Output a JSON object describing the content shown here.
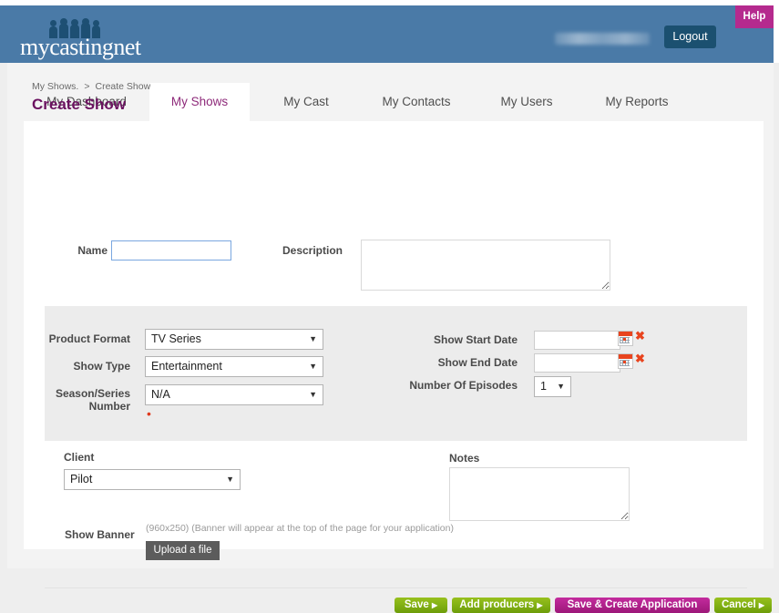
{
  "header": {
    "logo_text": "mycastingnet",
    "logo_icon": "people-group-icon",
    "username": "",
    "logout_label": "Logout",
    "help_label": "Help",
    "bar_color": "#4a7aa7",
    "help_color": "#b52a8e",
    "logout_color": "#1b5070"
  },
  "tabs": [
    {
      "label": "My Dashboard",
      "active": false
    },
    {
      "label": "My Shows",
      "active": true
    },
    {
      "label": "My Cast",
      "active": false
    },
    {
      "label": "My Contacts",
      "active": false
    },
    {
      "label": "My Users",
      "active": false
    },
    {
      "label": "My Reports",
      "active": false
    }
  ],
  "breadcrumb": {
    "parent": "My Shows.",
    "separator": ">",
    "current": "Create Show"
  },
  "page": {
    "title": "Create Show",
    "title_color": "#6b1260"
  },
  "form": {
    "name": {
      "label": "Name",
      "value": "",
      "placeholder": ""
    },
    "description": {
      "label": "Description",
      "value": "",
      "placeholder": ""
    },
    "product_format": {
      "label": "Product Format",
      "value": "TV Series",
      "options": [
        "TV Series"
      ]
    },
    "show_type": {
      "label": "Show Type",
      "value": "Entertainment",
      "options": [
        "Entertainment"
      ]
    },
    "season_number": {
      "label_line1": "Season/Series",
      "label_line2": "Number",
      "value": "N/A",
      "options": [
        "N/A"
      ],
      "required_marker": "•"
    },
    "show_start_date": {
      "label": "Show Start Date",
      "value": "",
      "placeholder": ""
    },
    "show_end_date": {
      "label": "Show End Date",
      "value": "",
      "placeholder": ""
    },
    "number_of_episodes": {
      "label": "Number Of Episodes",
      "value": "1",
      "options": [
        "1"
      ]
    },
    "client": {
      "label": "Client",
      "value": "Pilot",
      "options": [
        "Pilot"
      ]
    },
    "notes": {
      "label": "Notes",
      "value": "",
      "placeholder": ""
    },
    "show_banner": {
      "label": "Show Banner",
      "help_text": "(960x250) (Banner will appear at the top of the page for your application)",
      "upload_label": "Upload a file"
    }
  },
  "icons": {
    "calendar": "calendar-icon",
    "clear": "clear-date-icon",
    "dropdown_arrow": "▼",
    "button_arrow": "▶"
  },
  "actions": [
    {
      "label": "Save",
      "arrow": "▶",
      "style": "green"
    },
    {
      "label": "Add producers",
      "arrow": "▶",
      "style": "green"
    },
    {
      "label": "Save & Create Application",
      "arrow": "",
      "style": "magenta"
    },
    {
      "label": "Cancel",
      "arrow": "▶",
      "style": "green"
    }
  ],
  "colors": {
    "green_button": "#7fae12",
    "magenta_button": "#ae2089",
    "panel_gray": "#ececec",
    "page_gray": "#f3f3f3"
  }
}
